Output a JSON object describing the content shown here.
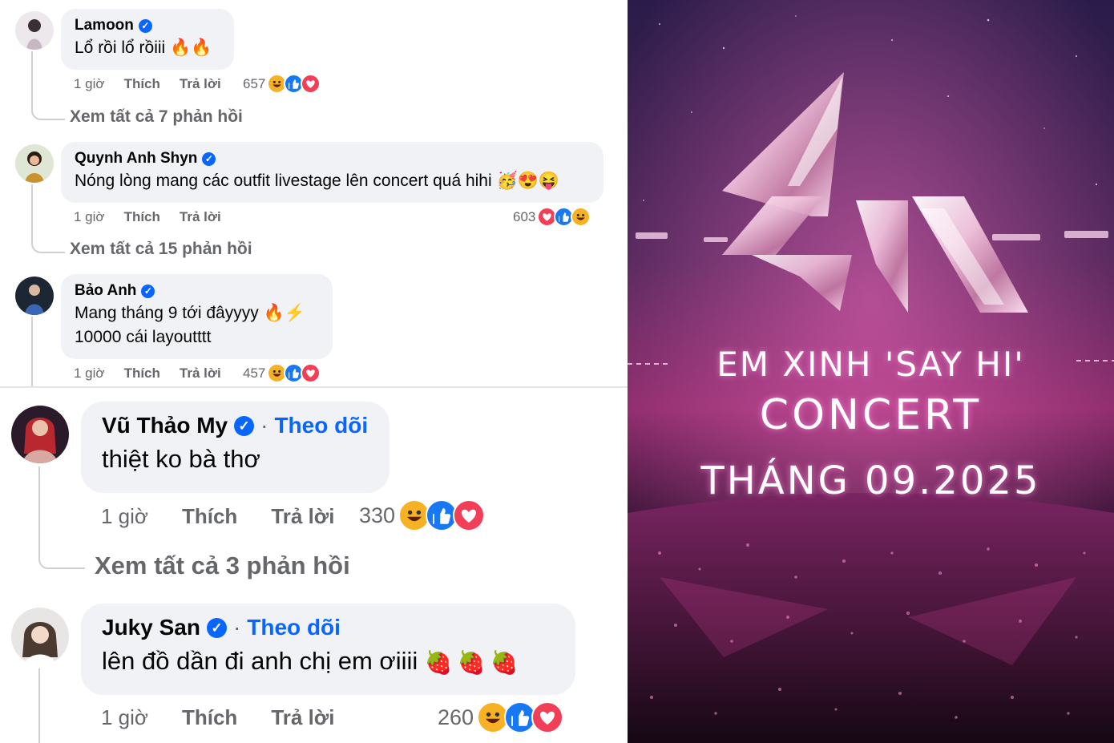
{
  "comments_small": [
    {
      "name": "Lamoon",
      "text": [
        "Lổ rồi lổ rồiii"
      ],
      "emojis": [
        "🔥",
        "🔥"
      ],
      "time": "1 giờ",
      "like": "Thích",
      "reply": "Trả lời",
      "reaction_count": "657",
      "reactions": [
        "haha",
        "like",
        "love"
      ],
      "view_replies": "Xem tất cả 7 phản hồi"
    },
    {
      "name": "Quynh Anh Shyn",
      "text": [
        "Nóng lòng mang các outfit livestage lên concert quá hihi"
      ],
      "emojis": [
        "🥳",
        "😍",
        "😝"
      ],
      "time": "1 giờ",
      "like": "Thích",
      "reply": "Trả lời",
      "reaction_count": "603",
      "reactions": [
        "love",
        "like",
        "haha"
      ],
      "view_replies": "Xem tất cả 15 phản hồi"
    },
    {
      "name": "Bảo Anh",
      "text": [
        "Mang tháng 9 tới đâyyyy",
        "10000 cái layoutttt"
      ],
      "emojis": [
        "🔥",
        "⚡"
      ],
      "time": "1 giờ",
      "like": "Thích",
      "reply": "Trả lời",
      "reaction_count": "457",
      "reactions": [
        "haha",
        "like",
        "love"
      ]
    }
  ],
  "comments_large": [
    {
      "name": "Vũ Thảo My",
      "follow": "Theo dõi",
      "separator": "·",
      "text": "thiệt ko bà thơ",
      "time": "1 giờ",
      "like": "Thích",
      "reply": "Trả lời",
      "reaction_count": "330",
      "reactions": [
        "haha",
        "like",
        "love"
      ],
      "view_replies": "Xem tất cả 3 phản hồi"
    },
    {
      "name": "Juky San",
      "follow": "Theo dõi",
      "separator": "·",
      "text": "lên đồ dần đi anh chị em ơiiii",
      "emojis": [
        "🍓",
        "🍓",
        "🍓"
      ],
      "time": "1 giờ",
      "like": "Thích",
      "reply": "Trả lời",
      "reaction_count": "260",
      "reactions": [
        "haha",
        "like",
        "love"
      ]
    }
  ],
  "poster": {
    "line1": "EM XINH 'SAY HI'",
    "line2": "CONCERT",
    "line3": "THÁNG 09.2025"
  },
  "colors": {
    "bubble": "#f0f2f5",
    "meta_text": "#65676b",
    "accent_blue": "#0866ff",
    "poster_pink": "#ff3fa4",
    "poster_purple": "#3b1a5e"
  }
}
